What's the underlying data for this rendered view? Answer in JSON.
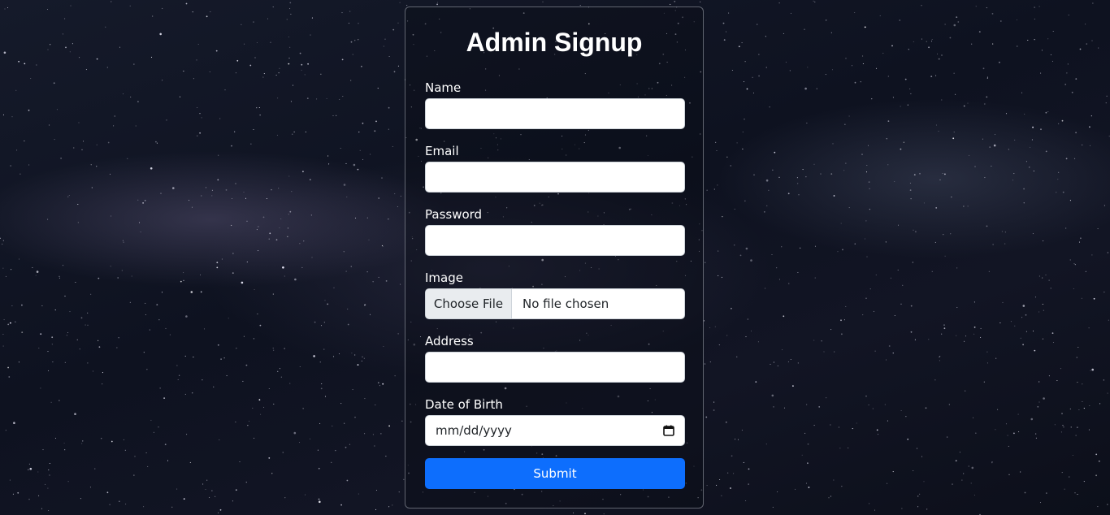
{
  "form": {
    "title": "Admin Signup",
    "fields": {
      "name": {
        "label": "Name",
        "value": ""
      },
      "email": {
        "label": "Email",
        "value": ""
      },
      "password": {
        "label": "Password",
        "value": ""
      },
      "image": {
        "label": "Image",
        "button_label": "Choose File",
        "status": "No file chosen"
      },
      "address": {
        "label": "Address",
        "value": ""
      },
      "dob": {
        "label": "Date of Birth",
        "placeholder": "mm/dd/yyyy",
        "icon": "calendar-icon"
      }
    },
    "submit_label": "Submit"
  },
  "colors": {
    "accent": "#0d6efd",
    "background": "#0e1220",
    "card_border": "#c8cdd7"
  }
}
